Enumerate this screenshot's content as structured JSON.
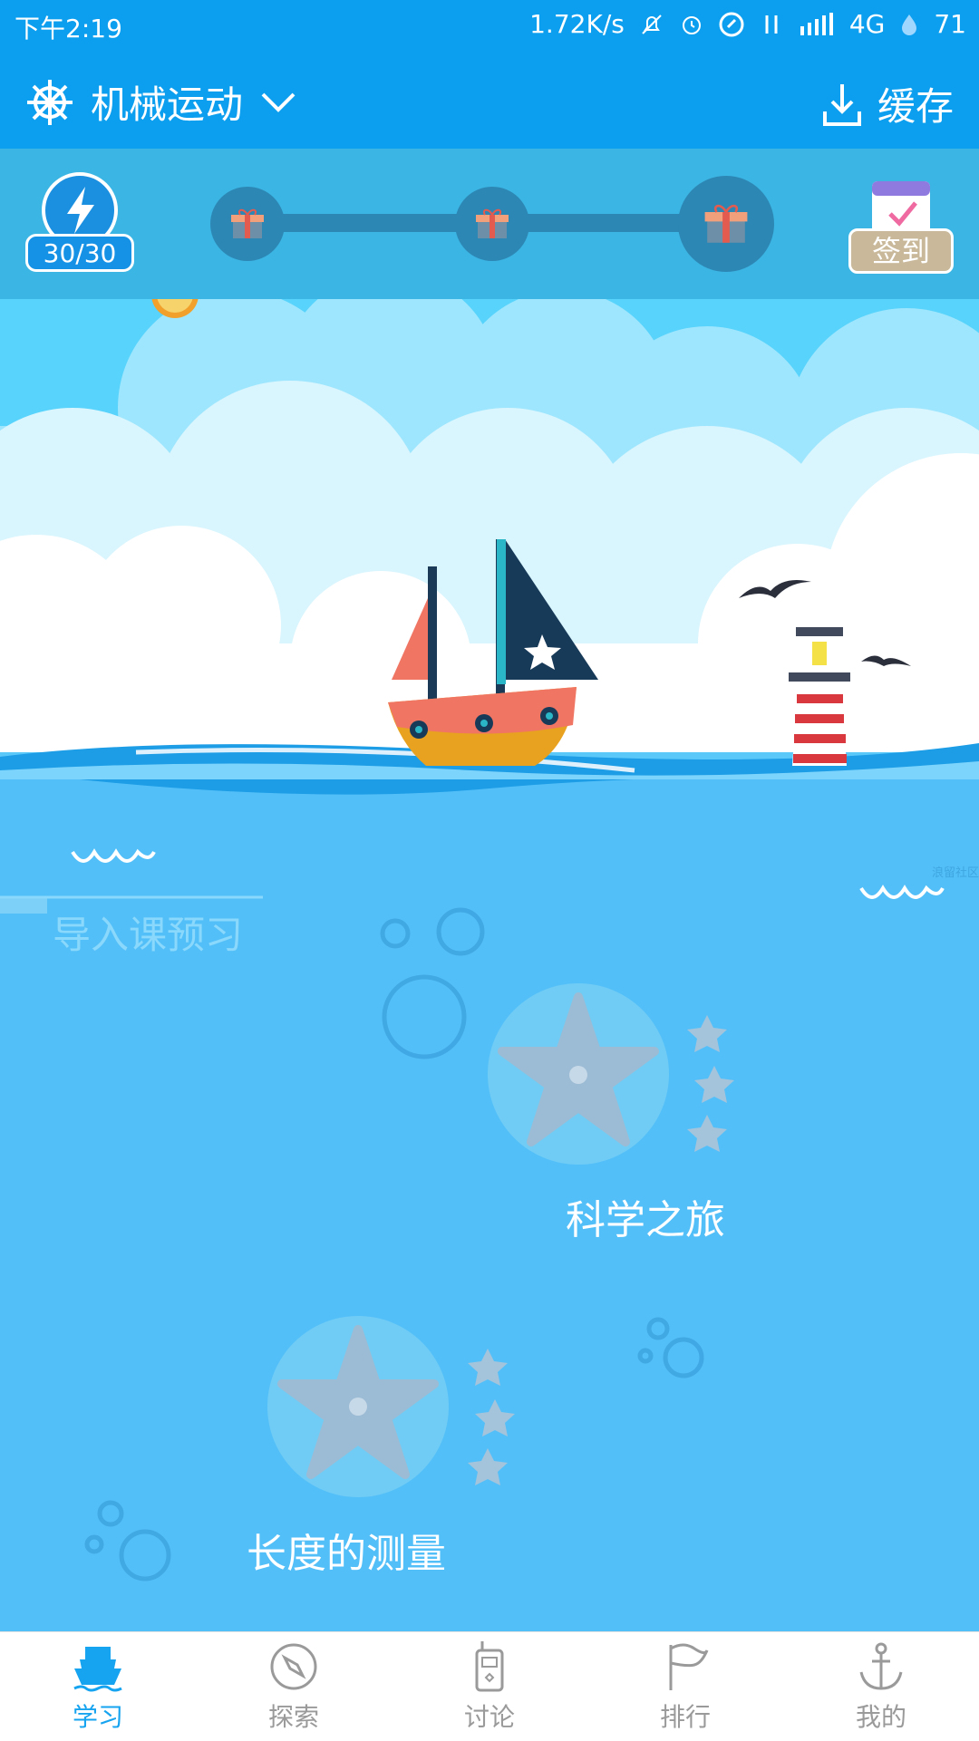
{
  "status_bar": {
    "time": "下午2:19",
    "speed": "1.72K/s",
    "network": "4G",
    "battery": "71"
  },
  "toolbar": {
    "title": "机械运动",
    "cache_label": "缓存"
  },
  "progress": {
    "energy": "30/30",
    "checkin_label": "签到"
  },
  "scene": {
    "preview_label": "导入课预习",
    "watermark": "浪留社区",
    "lessons": [
      {
        "label": "科学之旅",
        "stars_total": 3,
        "stars_earned": 0
      },
      {
        "label": "长度的测量",
        "stars_total": 3,
        "stars_earned": 0
      }
    ]
  },
  "bottom_nav": [
    {
      "label": "学习",
      "icon": "ship-icon",
      "active": true
    },
    {
      "label": "探索",
      "icon": "compass-icon",
      "active": false
    },
    {
      "label": "讨论",
      "icon": "walkie-talkie-icon",
      "active": false
    },
    {
      "label": "排行",
      "icon": "flag-icon",
      "active": false
    },
    {
      "label": "我的",
      "icon": "anchor-icon",
      "active": false
    }
  ],
  "colors": {
    "primary": "#0d9fef",
    "strip": "#3bb5e3",
    "ocean": "#5bc8fa",
    "active_nav": "#16a3ef"
  }
}
